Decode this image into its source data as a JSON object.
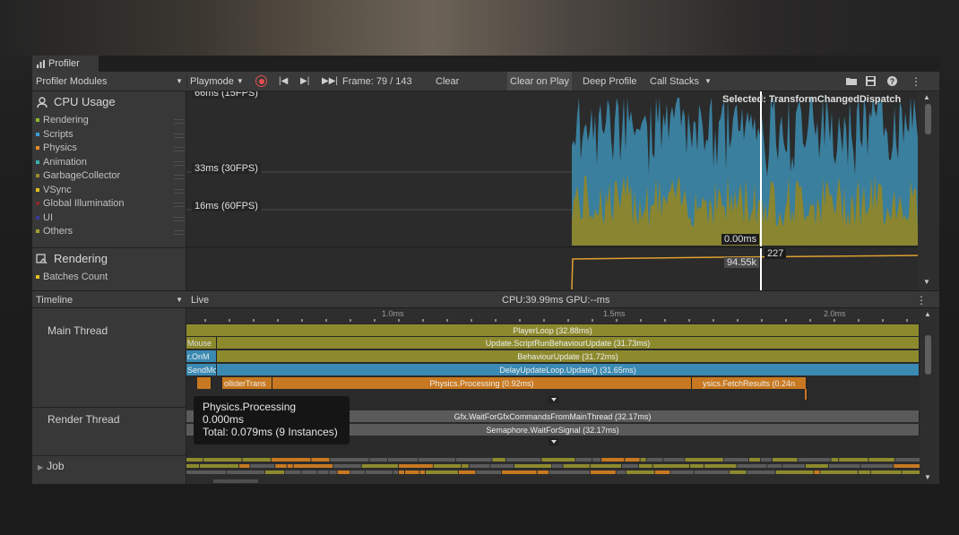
{
  "window": {
    "tab_title": "Profiler"
  },
  "toolbar": {
    "modules_dropdown": "Profiler Modules",
    "playmode": "Playmode",
    "frame": "Frame: 79 / 143",
    "clear": "Clear",
    "clear_on_play": "Clear on Play",
    "deep_profile": "Deep Profile",
    "call_stacks": "Call Stacks"
  },
  "cpu_module": {
    "title": "CPU Usage",
    "legend": [
      {
        "label": "Rendering",
        "color": "#8fb82f"
      },
      {
        "label": "Scripts",
        "color": "#3a9fd6"
      },
      {
        "label": "Physics",
        "color": "#e8892a"
      },
      {
        "label": "Animation",
        "color": "#3ab0b0"
      },
      {
        "label": "GarbageCollector",
        "color": "#9a8a2a"
      },
      {
        "label": "VSync",
        "color": "#e0c020"
      },
      {
        "label": "Global Illumination",
        "color": "#8a2a2a"
      },
      {
        "label": "UI",
        "color": "#3a3a9a"
      },
      {
        "label": "Others",
        "color": "#a8a030"
      }
    ],
    "grid_labels": [
      "66ms (15FPS)",
      "33ms (30FPS)",
      "16ms (60FPS)"
    ],
    "selected": "Selected: TransformChangedDispatch",
    "readout_value": "0.00ms"
  },
  "rendering_module": {
    "title": "Rendering",
    "legend": [
      {
        "label": "Batches Count",
        "color": "#e0c020"
      }
    ],
    "readout_value": "94.55k",
    "readout_value2": "227"
  },
  "timeline": {
    "view_dropdown": "Timeline",
    "live": "Live",
    "cpu_gpu": "CPU:39.99ms  GPU:--ms",
    "ruler_labels": [
      "1.0ms",
      "1.5ms",
      "2.0ms"
    ],
    "threads": [
      "Main Thread",
      "Render Thread",
      "Job"
    ],
    "main_bars": [
      {
        "label": "PlayerLoop (32.88ms)"
      },
      {
        "label": "Mouse"
      },
      {
        "label": "Update.ScriptRunBehaviourUpdate (31.73ms)"
      },
      {
        "label": "r.OnM"
      },
      {
        "label": "BehaviourUpdate (31.72ms)"
      },
      {
        "label": "SendMo"
      },
      {
        "label": "DelayUpdateLoop.Update() (31.65ms)"
      },
      {
        "label": "olliderTrans"
      },
      {
        "label": "Physics.Processing (0.92ms)"
      },
      {
        "label": "ysics.FetchResults (0.24n"
      }
    ],
    "render_bars": [
      {
        "label": "Gfx.WaitForGfxCommandsFromMainThread (32.17ms)"
      },
      {
        "label": "Semaphore.WaitForSignal (32.17ms)"
      }
    ],
    "tooltip": {
      "name": "Physics.Processing",
      "self_time": "0.000ms",
      "total": "Total: 0.079ms (9 Instances)"
    }
  },
  "colors": {
    "scripts": "#3a8ab3",
    "rendering": "#8d8a2e",
    "physics": "#c87820"
  }
}
